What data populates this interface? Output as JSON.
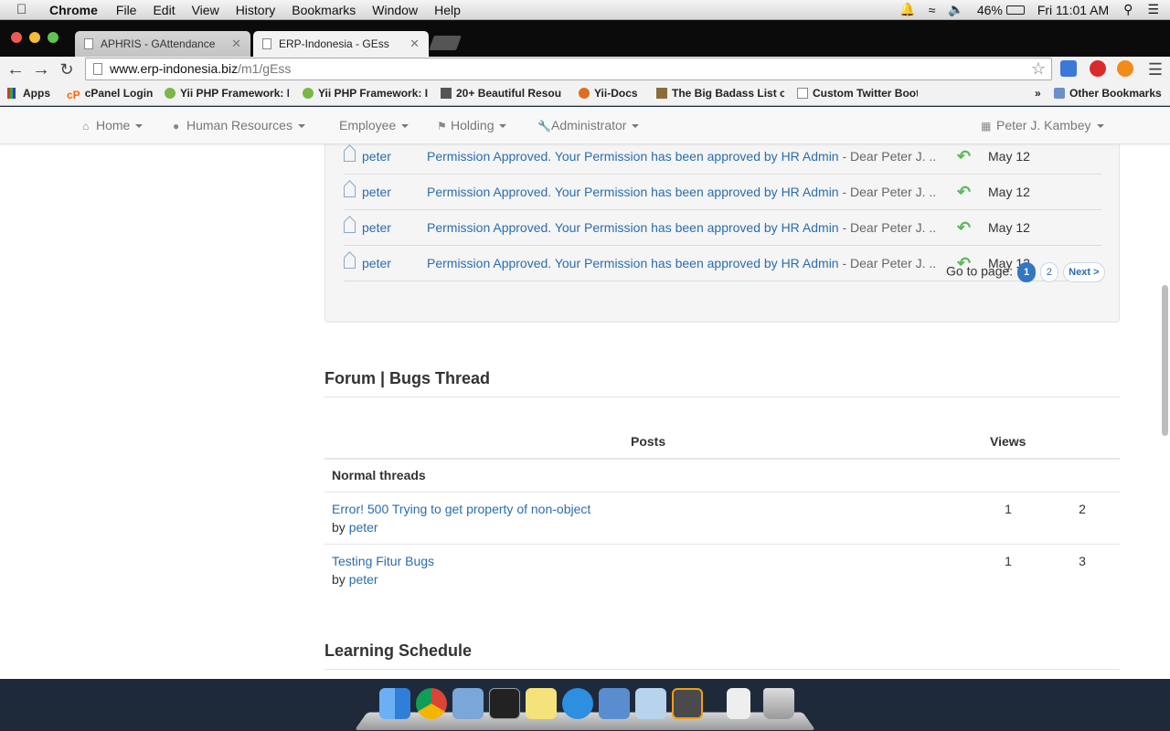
{
  "menubar": {
    "app": "Chrome",
    "items": [
      "File",
      "Edit",
      "View",
      "History",
      "Bookmarks",
      "Window",
      "Help"
    ],
    "battery": "46%",
    "clock": "Fri 11:01 AM"
  },
  "tabs": [
    {
      "title": "APHRIS - GAttendance",
      "active": false
    },
    {
      "title": "ERP-Indonesia - GEss",
      "active": true
    }
  ],
  "toolbar": {
    "url_host": "www.erp-indonesia.biz",
    "url_path": "/m1/gEss"
  },
  "bookmarks": {
    "apps": "Apps",
    "items": [
      "cPanel Login",
      "Yii PHP Framework: I",
      "Yii PHP Framework: I",
      "20+ Beautiful Resou",
      "Yii-Docs",
      "The Big Badass List o",
      "Custom Twitter Boot"
    ],
    "other": "Other Bookmarks"
  },
  "nav": {
    "home": "Home",
    "hr": "Human Resources",
    "employee": "Employee",
    "holding": "Holding",
    "admin": "Administrator",
    "user": "Peter J. Kambey"
  },
  "inbox": {
    "rows": [
      {
        "sender": "peter",
        "subject": "Permission Approved. Your Permission has been approved by HR Admin",
        "preview": " - Dear Peter J. ..",
        "date": "May 12"
      },
      {
        "sender": "peter",
        "subject": "Permission Approved. Your Permission has been approved by HR Admin",
        "preview": " - Dear Peter J. ..",
        "date": "May 12"
      },
      {
        "sender": "peter",
        "subject": "Permission Approved. Your Permission has been approved by HR Admin",
        "preview": " - Dear Peter J. ..",
        "date": "May 12"
      },
      {
        "sender": "peter",
        "subject": "Permission Approved. Your Permission has been approved by HR Admin",
        "preview": " - Dear Peter J. ..",
        "date": "May 12"
      }
    ],
    "pager_label": "Go to page:",
    "pages": [
      "1",
      "2"
    ],
    "next": "Next >"
  },
  "forum": {
    "title": "Forum | Bugs Thread",
    "col_posts": "Posts",
    "col_views": "Views",
    "group": "Normal threads",
    "threads": [
      {
        "title": "Error! 500 Trying to get property of non-object",
        "by": "by",
        "author": "peter",
        "posts": "1",
        "views": "2"
      },
      {
        "title": "Testing Fitur Bugs",
        "by": "by",
        "author": "peter",
        "posts": "1",
        "views": "3"
      }
    ]
  },
  "learning": {
    "title": "Learning Schedule"
  }
}
